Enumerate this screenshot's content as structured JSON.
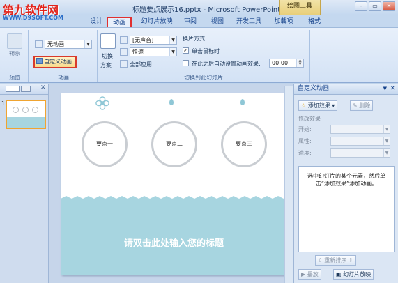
{
  "watermark": {
    "logo": "第九软件网",
    "url": "WWW.D9SOFT.COM"
  },
  "window": {
    "title": "标题要点展示16.pptx - Microsoft PowerPoint",
    "context_tab": "绘图工具",
    "minimize": "–",
    "restore": "▭",
    "close": "✕"
  },
  "tabs": [
    {
      "label": "设计"
    },
    {
      "label": "动画"
    },
    {
      "label": "幻灯片放映"
    },
    {
      "label": "审阅"
    },
    {
      "label": "视图"
    },
    {
      "label": "开发工具"
    },
    {
      "label": "加载项"
    },
    {
      "label": "格式"
    }
  ],
  "ribbon": {
    "preview_label": "预览",
    "preview_group": "预览",
    "animation_combo": "无动画",
    "custom_animation": "自定义动画",
    "animation_group": "动画",
    "switch_label_1": "切换",
    "switch_label_2": "方案",
    "sound_combo": "[无声音]",
    "speed_combo": "快速",
    "apply_all": "全部应用",
    "switch_mode": "换片方式",
    "on_click": "单击鼠标时",
    "auto_after": "在此之后自动设置动画效果:",
    "time_value": "00:00",
    "transition_group": "切换到此幻灯片"
  },
  "slide": {
    "points": [
      "要点一",
      "要点二",
      "要点三"
    ],
    "title_placeholder": "请双击此处输入您的标题"
  },
  "task_pane": {
    "title": "自定义动画",
    "add_effect": "添加效果",
    "remove": "删除",
    "modify_label": "修改效果",
    "start_label": "开始:",
    "property_label": "属性:",
    "speed_label": "速度:",
    "hint": "选中幻灯片的某个元素，然后单击“添加效果”添加动画。",
    "reorder": "重新排序",
    "play": "播放",
    "slideshow": "幻灯片放映"
  },
  "colors": {
    "accent_red": "#d83a2c",
    "sea": "#a7d5e0",
    "ribbon": "#dbe6f4"
  }
}
